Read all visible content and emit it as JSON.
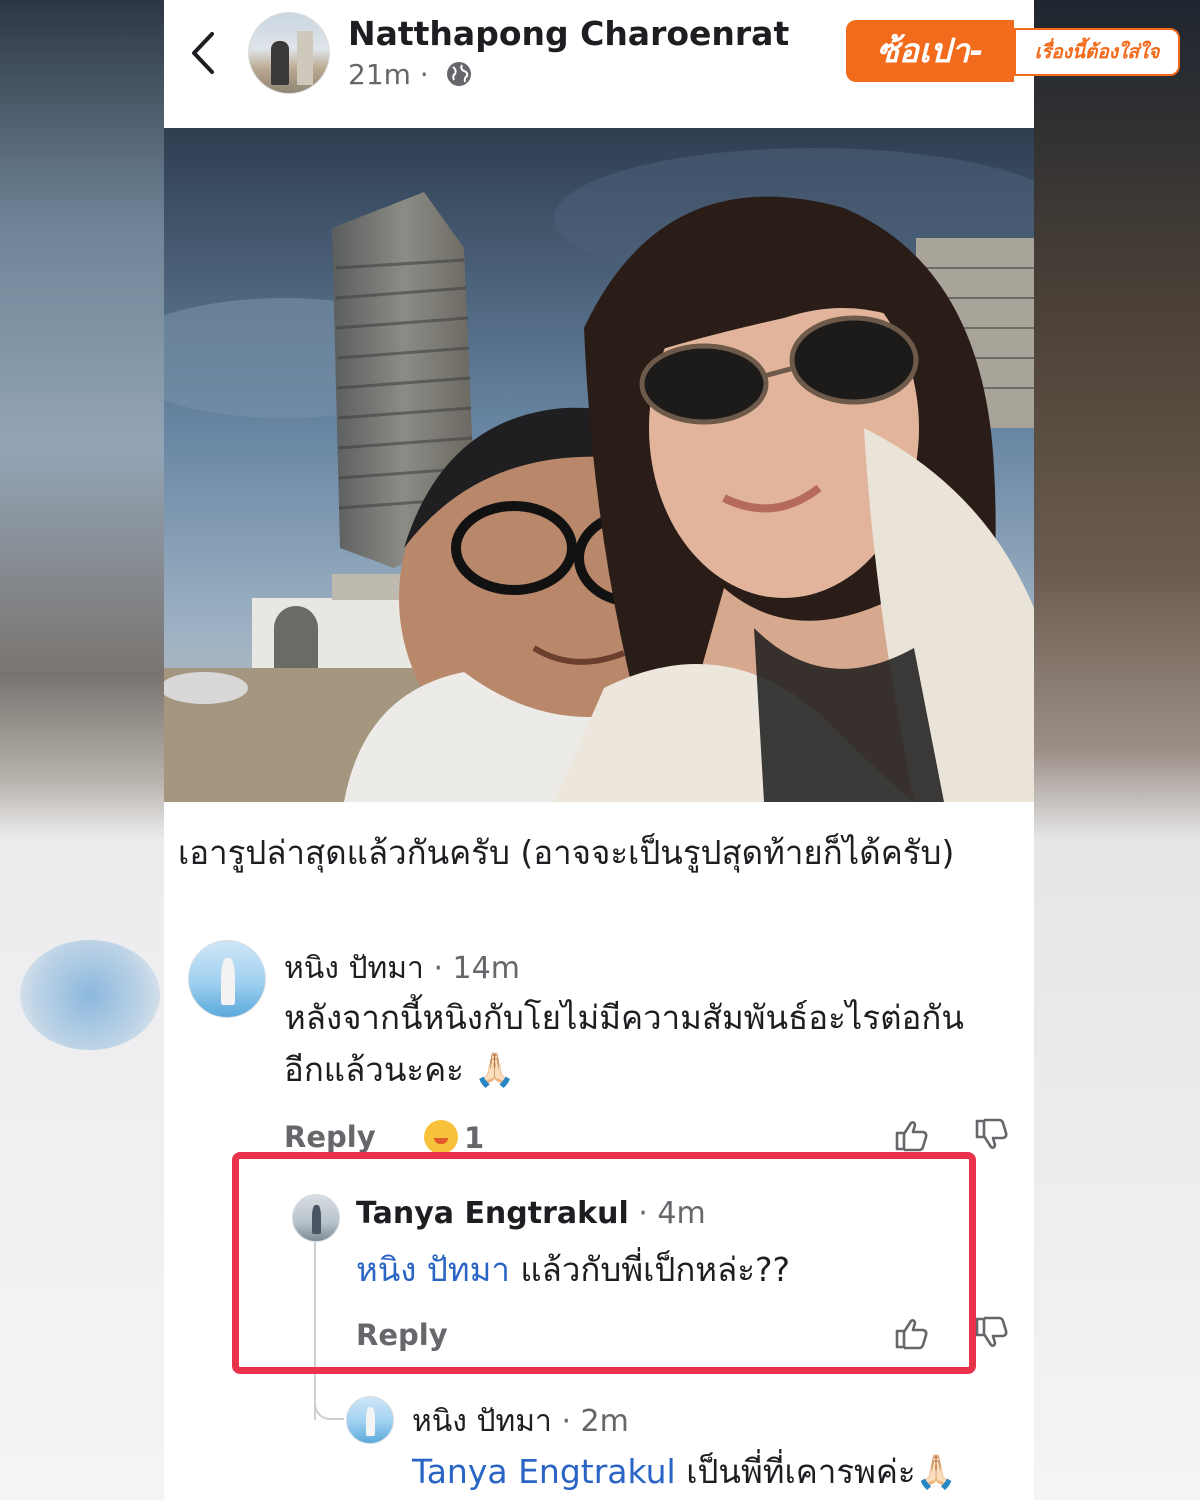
{
  "post": {
    "author_name": "Natthapong Charoenrat",
    "time": "21m",
    "separator": " · ",
    "caption": "เอารูปล่าสุดแล้วกันครับ (อาจจะเป็นรูปสุดท้ายก็ได้ครับ)"
  },
  "watermark": {
    "main": "ซ้อเปา-",
    "sub": "เรื่องนี้ต้องใส่ใจ"
  },
  "comments": [
    {
      "name": "หนิง ปัทมา",
      "time": " · 14m",
      "text": "หลังจากนี้หนิงกับโยไม่มีความสัมพันธ์อะไรต่อกันอีกแล้วนะคะ 🙏🏻",
      "reply_label": "Reply",
      "reaction_count": "1"
    },
    {
      "name": "Tanya Engtrakul",
      "time": " · 4m",
      "mention": "หนิง ปัทมา",
      "text": " แล้วกับพี่เป็กหล่ะ??",
      "reply_label": "Reply"
    },
    {
      "name": "หนิง ปัทมา",
      "time": " · 2m",
      "mention": "Tanya Engtrakul",
      "text": " เป็นพี่ที่เคารพค่ะ🙏🏻"
    }
  ],
  "icons": {
    "back": "chevron-left-icon",
    "privacy": "globe-icon",
    "like": "thumbs-up-icon",
    "dislike": "thumbs-down-icon",
    "reaction": "care-emoji-icon"
  },
  "colors": {
    "brand_orange": "#f26a1b",
    "highlight_red": "#e8334b",
    "mention_blue": "#2a64c4"
  }
}
